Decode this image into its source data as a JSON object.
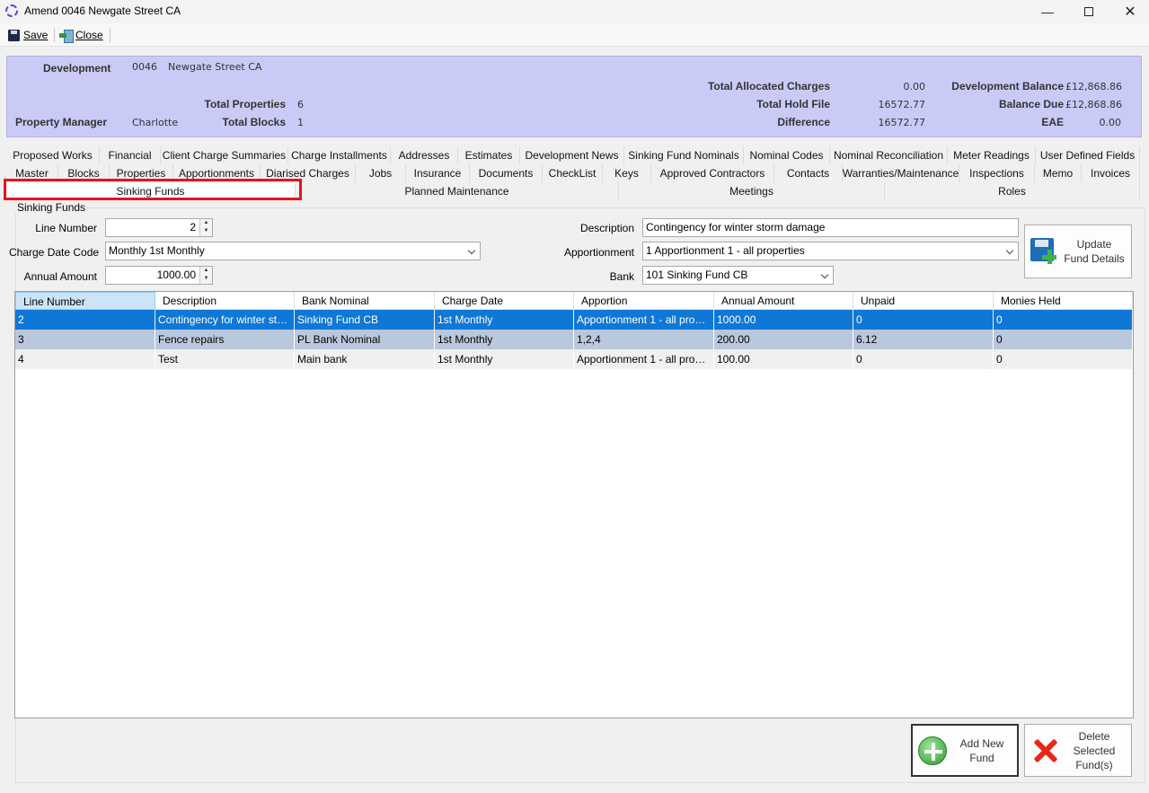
{
  "window": {
    "title": "Amend 0046 Newgate Street CA"
  },
  "toolbar": {
    "save_label": "Save",
    "close_label": "Close"
  },
  "header": {
    "development_label": "Development",
    "development_code": "0046",
    "development_name": "Newgate Street CA",
    "total_properties_label": "Total Properties",
    "total_properties": "6",
    "property_manager_label": "Property Manager",
    "property_manager": "Charlotte",
    "total_blocks_label": "Total Blocks",
    "total_blocks": "1",
    "total_allocated_charges_label": "Total Allocated Charges",
    "total_allocated_charges": "0.00",
    "total_hold_file_label": "Total Hold File",
    "total_hold_file": "16572.77",
    "difference_label": "Difference",
    "difference": "16572.77",
    "development_balance_label": "Development Balance",
    "development_balance": "£12,868.86",
    "balance_due_label": "Balance Due",
    "balance_due": "£12,868.86",
    "eae_label": "EAE",
    "eae": "0.00"
  },
  "tabs_row1": [
    "Proposed Works",
    "Financial",
    "Client Charge Summaries",
    "Charge Installments",
    "Addresses",
    "Estimates",
    "Development News",
    "Sinking Fund Nominals",
    "Nominal Codes",
    "Nominal Reconciliation",
    "Meter Readings",
    "User Defined Fields"
  ],
  "tabs_row2": [
    "Master",
    "Blocks",
    "Properties",
    "Apportionments",
    "Diarised Charges",
    "Jobs",
    "Insurance",
    "Documents",
    "CheckList",
    "Keys",
    "Approved Contractors",
    "Contacts",
    "Warranties/Maintenance",
    "Inspections",
    "Memo",
    "Invoices"
  ],
  "tabs_row3": [
    "Sinking Funds",
    "Planned Maintenance",
    "Meetings",
    "Roles"
  ],
  "active_tab": "Sinking Funds",
  "form": {
    "group_title": "Sinking Funds",
    "line_number_label": "Line Number",
    "line_number": "2",
    "charge_date_code_label": "Charge Date Code",
    "charge_date_code": "Monthly 1st Monthly",
    "annual_amount_label": "Annual Amount",
    "annual_amount": "1000.00",
    "description_label": "Description",
    "description": "Contingency for winter storm damage",
    "apportionment_label": "Apportionment",
    "apportionment": "1   Apportionment 1 - all properties",
    "bank_label": "Bank",
    "bank": "101   Sinking Fund CB",
    "update_label_1": "Update",
    "update_label_2": "Fund Details"
  },
  "grid": {
    "columns": [
      "Line Number",
      "Description",
      "Bank Nominal",
      "Charge Date",
      "Apportion",
      "Annual Amount",
      "Unpaid",
      "Monies Held"
    ],
    "rows": [
      [
        "2",
        "Contingency for winter storm ...",
        "Sinking Fund CB",
        "1st Monthly",
        "Apportionment 1 - all properties",
        "1000.00",
        "0",
        "0"
      ],
      [
        "3",
        "Fence repairs",
        "PL Bank Nominal",
        "1st Monthly",
        "1,2,4",
        "200.00",
        "6.12",
        "0"
      ],
      [
        "4",
        "Test",
        "Main bank",
        "1st Monthly",
        "Apportionment 1 - all properties",
        "100.00",
        "0",
        "0"
      ]
    ]
  },
  "buttons": {
    "add_1": "Add New",
    "add_2": "Fund",
    "delete_1": "Delete",
    "delete_2": "Selected",
    "delete_3": "Fund(s)"
  },
  "colors": {
    "header_bg": "#cacaf7",
    "selection": "#0f78d7",
    "highlight": "#e8131a"
  }
}
